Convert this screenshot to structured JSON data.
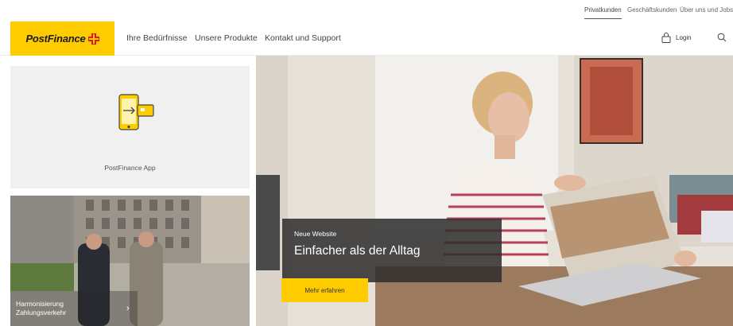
{
  "topbar": {
    "links": [
      "Privatkunden",
      "Geschäftskunden",
      "Über uns und Jobs"
    ]
  },
  "header": {
    "logo_text": "PostFinance",
    "nav": [
      "Ihre Bedürfnisse",
      "Unsere Produkte",
      "Kontakt und Support"
    ],
    "login_label": "Login",
    "brand_yellow": "#ffcc00",
    "brand_red": "#e2001a"
  },
  "tiles": {
    "app_label": "PostFinance App",
    "news_caption_line1": "Harmonisierung",
    "news_caption_line2": "Zahlungsverkehr"
  },
  "hero": {
    "kicker": "Neue Website",
    "title": "Einfacher als der Alltag",
    "cta_label": "Mehr erfahren"
  }
}
